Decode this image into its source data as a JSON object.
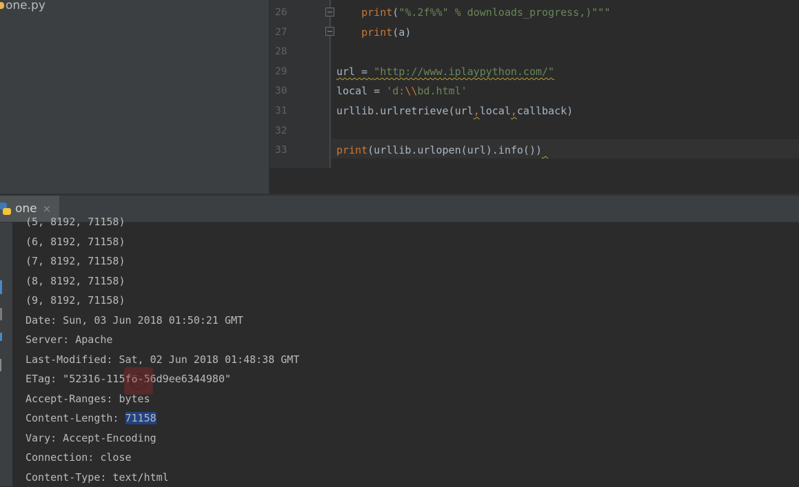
{
  "project": {
    "file_name": "one.py"
  },
  "editor": {
    "line_numbers": [
      "26",
      "27",
      "28",
      "29",
      "30",
      "31",
      "32",
      "33"
    ],
    "lines": [
      {
        "parts": [
          {
            "t": "    ",
            "c": ""
          },
          {
            "t": "print",
            "c": "kw"
          },
          {
            "t": "(",
            "c": ""
          },
          {
            "t": "\"%.2f%%\" % downloads_progress,)\"\"\"",
            "c": "str"
          }
        ]
      },
      {
        "parts": [
          {
            "t": "    ",
            "c": ""
          },
          {
            "t": "print",
            "c": "kw"
          },
          {
            "t": "(a)",
            "c": ""
          }
        ]
      },
      {
        "parts": []
      },
      {
        "parts": [
          {
            "t": "url = ",
            "c": "sq"
          },
          {
            "t": "\"http://www.iplaypython.com/\"",
            "c": "str sq"
          }
        ]
      },
      {
        "parts": [
          {
            "t": "local = ",
            "c": ""
          },
          {
            "t": "'d:",
            "c": "str"
          },
          {
            "t": "\\\\",
            "c": "esc"
          },
          {
            "t": "bd.html'",
            "c": "str"
          }
        ]
      },
      {
        "parts": [
          {
            "t": "urllib.urlretrieve(url",
            "c": ""
          },
          {
            "t": ",",
            "c": "kw sq"
          },
          {
            "t": "local",
            "c": ""
          },
          {
            "t": ",",
            "c": "kw sq"
          },
          {
            "t": "callback)",
            "c": ""
          }
        ]
      },
      {
        "parts": []
      },
      {
        "parts": [
          {
            "t": "print",
            "c": "kw"
          },
          {
            "t": "(urllib.urlopen(url).info())",
            "c": ""
          },
          {
            "t": " ",
            "c": "sq"
          }
        ]
      }
    ]
  },
  "run": {
    "tab_label": "one",
    "close_glyph": "×"
  },
  "console": {
    "lines": [
      "(5, 8192, 71158)",
      "(6, 8192, 71158)",
      "(7, 8192, 71158)",
      "(8, 8192, 71158)",
      "(9, 8192, 71158)",
      "Date: Sun, 03 Jun 2018 01:50:21 GMT",
      "Server: Apache",
      "Last-Modified: Sat, 02 Jun 2018 01:48:38 GMT",
      "ETag: \"52316-115f6-56d9ee6344980\"",
      "Accept-Ranges: bytes",
      "Content-Length: ",
      "Vary: Accept-Encoding",
      "Connection: close",
      "Content-Type: text/html"
    ],
    "selected_text": "71158",
    "selected_line_index": 10
  },
  "colors": {
    "keyword": "#cc7832",
    "string": "#6a8759",
    "text": "#a9b7c6",
    "selection": "#214283"
  }
}
